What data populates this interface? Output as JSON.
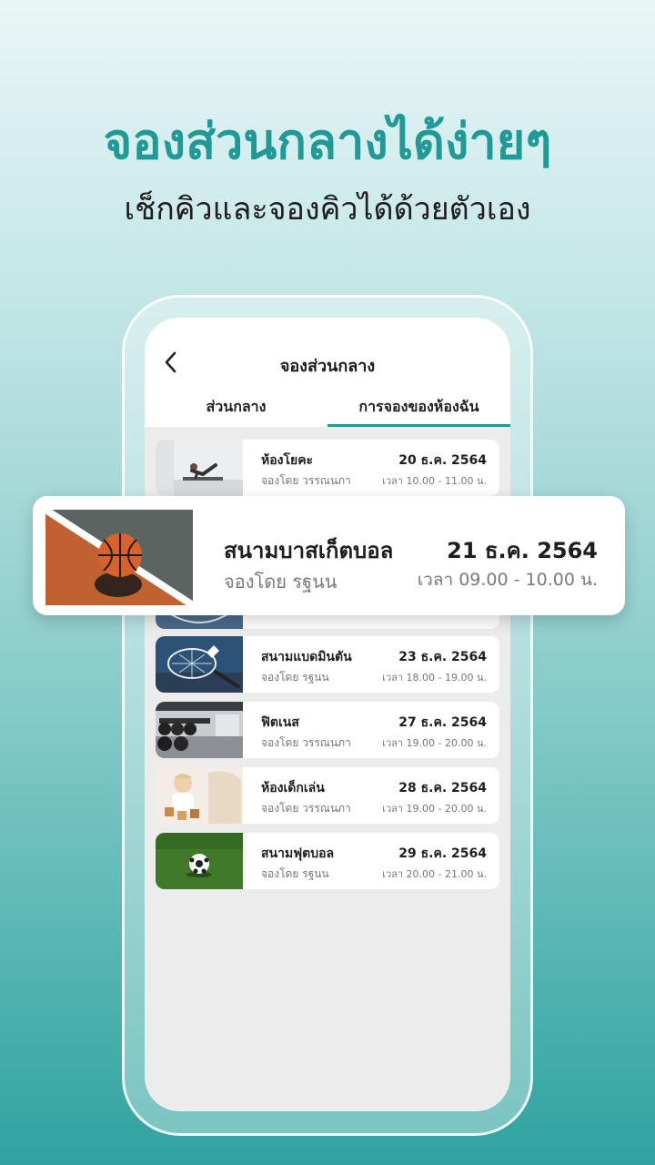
{
  "promo": {
    "headline": "จองส่วนกลางได้ง่ายๆ",
    "subheadline": "เช็กคิวและจองคิวได้ด้วยตัวเอง"
  },
  "app": {
    "title": "จองส่วนกลาง",
    "back_icon": "chevron-left-icon",
    "tabs": [
      {
        "label": "ส่วนกลาง",
        "active": false
      },
      {
        "label": "การจองของห้องฉัน",
        "active": true
      }
    ],
    "accent_color": "#1f9a97"
  },
  "highlight": {
    "name": "สนามบาสเก็ตบอล",
    "booked_by": "จองโดย รฐนน",
    "date": "21 ธ.ค. 2564",
    "time": "เวลา 09.00 - 10.00 น.",
    "thumb_icon": "basketball-icon"
  },
  "bookings": [
    {
      "name": "ห้องโยคะ",
      "booked_by": "จองโดย วรรณนภา",
      "date": "20 ธ.ค. 2564",
      "time": "เวลา 10.00 - 11.00 น.",
      "thumb_icon": "yoga-icon"
    },
    {
      "name": "สนามแบดมินตัน",
      "booked_by": "จองโดย รฐนน",
      "date": "23 ธ.ค. 2564",
      "time": "เวลา 18.00 - 19.00 น.",
      "thumb_icon": "badminton-icon"
    },
    {
      "name": "ฟิตเนส",
      "booked_by": "จองโดย วรรณนภา",
      "date": "27 ธ.ค. 2564",
      "time": "เวลา 19.00 - 20.00 น.",
      "thumb_icon": "gym-icon"
    },
    {
      "name": "ห้องเด็กเล่น",
      "booked_by": "จองโดย วรรณนภา",
      "date": "28 ธ.ค. 2564",
      "time": "เวลา 19.00 - 20.00 น.",
      "thumb_icon": "playroom-icon"
    },
    {
      "name": "สนามฟุตบอล",
      "booked_by": "จองโดย รฐนน",
      "date": "29 ธ.ค. 2564",
      "time": "เวลา 20.00 - 21.00 น.",
      "thumb_icon": "football-icon"
    }
  ]
}
